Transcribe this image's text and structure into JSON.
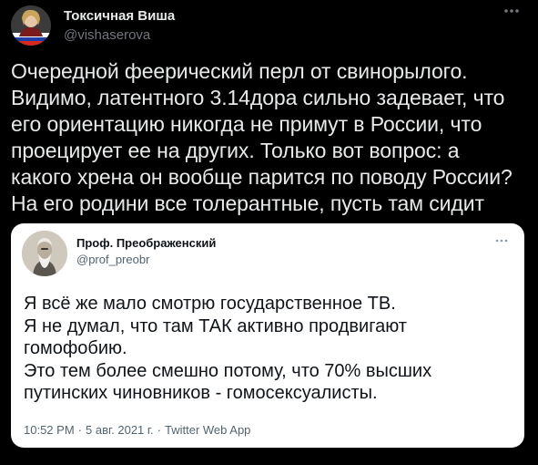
{
  "author": {
    "display_name": "Токсичная Виша",
    "handle": "@vishaserova",
    "avatar_icon": "avatar-flag-icon"
  },
  "tweet": {
    "lines": [
      "Очередной феерический перл от свинорылого.",
      "Видимо, латентного 3.14дора сильно задевает, что",
      "его ориентацию никогда не примут в России, что",
      "проецирует ее на других. Только вот вопрос: а",
      "какого хрена он вообще парится по поводу России?",
      "На его родини все толерантные, пусть там сидит"
    ]
  },
  "quoted": {
    "display_name": "Проф. Преображенский",
    "handle": "@prof_preobr",
    "lines": [
      "Я всё же мало смотрю государственное ТВ.",
      "Я не думал, что там ТАК активно продвигают",
      "гомофобию.",
      "Это тем более смешно потому, что 70% высших",
      "путинских чиновников - гомосексуалисты."
    ],
    "time": "10:52 PM",
    "date": "5 авг. 2021 г.",
    "source": "Twitter Web App",
    "separator": "·"
  },
  "icons": {
    "more": "more-dots-icon"
  },
  "colors": {
    "background": "#000000",
    "text_primary": "#e7e9ea",
    "text_secondary": "#71767b",
    "quote_background": "#ffffff",
    "quote_text": "#0f1419",
    "quote_secondary": "#536471"
  }
}
